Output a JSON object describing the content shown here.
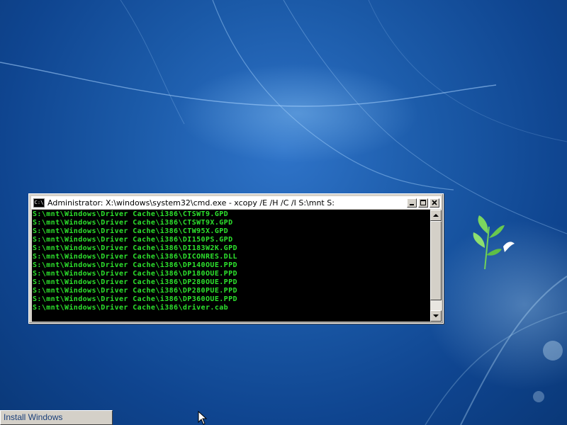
{
  "window": {
    "title": "Administrator: X:\\windows\\system32\\cmd.exe - xcopy  /E /H /C /I S:\\mnt S:",
    "icon_label": "C:\\",
    "buttons": [
      "minimize-icon",
      "maximize-icon",
      "close-icon"
    ]
  },
  "console": {
    "lines": [
      "S:\\mnt\\Windows\\Driver Cache\\i386\\CTSWT9.GPD",
      "S:\\mnt\\Windows\\Driver Cache\\i386\\CTSWT9X.GPD",
      "S:\\mnt\\Windows\\Driver Cache\\i386\\CTW95X.GPD",
      "S:\\mnt\\Windows\\Driver Cache\\i386\\DI150PS.GPD",
      "S:\\mnt\\Windows\\Driver Cache\\i386\\DI183W2K.GPD",
      "S:\\mnt\\Windows\\Driver Cache\\i386\\DICONRES.DLL",
      "S:\\mnt\\Windows\\Driver Cache\\i386\\DP140OUE.PPD",
      "S:\\mnt\\Windows\\Driver Cache\\i386\\DP180OUE.PPD",
      "S:\\mnt\\Windows\\Driver Cache\\i386\\DP280OUE.PPD",
      "S:\\mnt\\Windows\\Driver Cache\\i386\\DP280PUE.PPD",
      "S:\\mnt\\Windows\\Driver Cache\\i386\\DP360OUE.PPD",
      "S:\\mnt\\Windows\\Driver Cache\\i386\\driver.cab"
    ],
    "text_color": "#2de22d",
    "background": "#000000"
  },
  "taskbar": {
    "button_label": "Install Windows"
  },
  "icons": {
    "cursor": "arrow-cursor-icon",
    "logo": "windows-bird-plant-logo"
  },
  "colors": {
    "desktop": "#1b5aa8",
    "window_chrome": "#d4d0c8"
  }
}
